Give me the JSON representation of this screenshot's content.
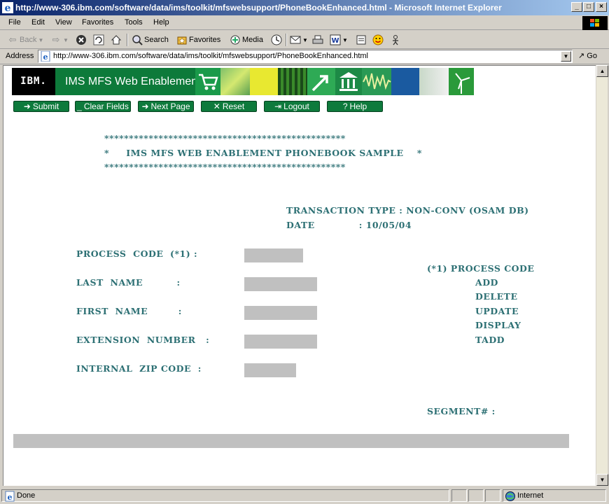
{
  "window": {
    "title": "http://www-306.ibm.com/software/data/ims/toolkit/mfswebsupport/PhoneBookEnhanced.html - Microsoft Internet Explorer",
    "minimize": "_",
    "maximize": "□",
    "close": "×"
  },
  "menu": {
    "items": [
      "File",
      "Edit",
      "View",
      "Favorites",
      "Tools",
      "Help"
    ]
  },
  "toolbar": {
    "back": "Back",
    "search": "Search",
    "favorites": "Favorites",
    "media": "Media"
  },
  "address": {
    "label": "Address",
    "url": "http://www-306.ibm.com/software/data/ims/toolkit/mfswebsupport/PhoneBookEnhanced.html",
    "go": "Go"
  },
  "banner": {
    "logo": "IBM.",
    "title": "IMS MFS Web Enablement"
  },
  "actions": {
    "submit": "Submit",
    "clear": "Clear Fields",
    "next": "Next Page",
    "reset": "Reset",
    "logout": "Logout",
    "help": "Help"
  },
  "form": {
    "stars": "*************************************************",
    "heading": "*     IMS MFS WEB ENABLEMENT PHONEBOOK SAMPLE    *",
    "transaction_type": "TRANSACTION TYPE : NON-CONV (OSAM DB)",
    "date": "DATE             : 10/05/04",
    "process_code_label": "PROCESS  CODE  (*1) :",
    "last_name_label": "LAST  NAME          :",
    "first_name_label": "FIRST  NAME         :",
    "extension_label": "EXTENSION  NUMBER   :",
    "zip_label": "INTERNAL  ZIP CODE  :",
    "legend_title": "(*1) PROCESS CODE",
    "codes": [
      "ADD",
      "DELETE",
      "UPDATE",
      "DISPLAY",
      "TADD"
    ],
    "segment": "SEGMENT# :",
    "values": {
      "process_code": "",
      "last_name": "",
      "first_name": "",
      "extension": "",
      "zip": ""
    }
  },
  "status": {
    "text": "Done",
    "zone": "Internet"
  }
}
